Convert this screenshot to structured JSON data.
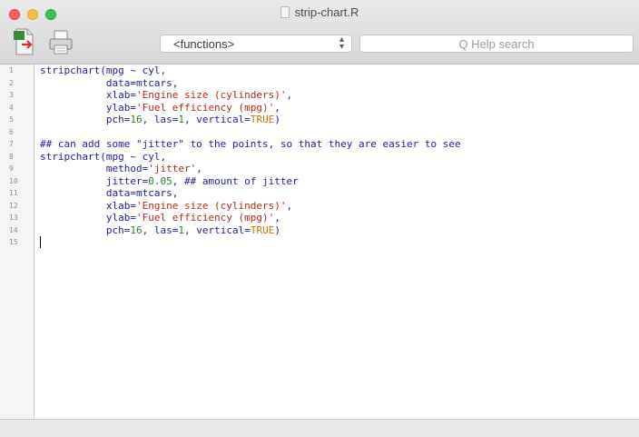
{
  "window": {
    "title": "strip-chart.R"
  },
  "toolbar": {
    "functions_label": "<functions>",
    "help_placeholder": "Q Help search",
    "source_icon": "source-file-icon",
    "print_icon": "printer-icon"
  },
  "editor": {
    "line_numbers": [
      "1",
      "2",
      "3",
      "4",
      "5",
      "6",
      "7",
      "8",
      "9",
      "10",
      "11",
      "12",
      "13",
      "14",
      "15"
    ],
    "lines": [
      [
        {
          "t": "stripchart(mpg ~ cyl,",
          "c": "id"
        }
      ],
      [
        {
          "t": "           data=mtcars,",
          "c": "id"
        }
      ],
      [
        {
          "t": "           xlab=",
          "c": "id"
        },
        {
          "t": "'Engine size (cylinders)'",
          "c": "str"
        },
        {
          "t": ",",
          "c": "id"
        }
      ],
      [
        {
          "t": "           ylab=",
          "c": "id"
        },
        {
          "t": "'Fuel efficiency (mpg)'",
          "c": "str"
        },
        {
          "t": ",",
          "c": "id"
        }
      ],
      [
        {
          "t": "           pch=",
          "c": "id"
        },
        {
          "t": "16",
          "c": "num"
        },
        {
          "t": ", las=",
          "c": "id"
        },
        {
          "t": "1",
          "c": "num"
        },
        {
          "t": ", vertical=",
          "c": "id"
        },
        {
          "t": "TRUE",
          "c": "bool"
        },
        {
          "t": ")",
          "c": "id"
        }
      ],
      [],
      [
        {
          "t": "## can add some \"jitter\" to the points, so that they are easier to see",
          "c": "cmt"
        }
      ],
      [
        {
          "t": "stripchart(mpg ~ cyl,",
          "c": "id"
        }
      ],
      [
        {
          "t": "           method=",
          "c": "id"
        },
        {
          "t": "'jitter'",
          "c": "str"
        },
        {
          "t": ",",
          "c": "id"
        }
      ],
      [
        {
          "t": "           jitter=",
          "c": "id"
        },
        {
          "t": "0.05",
          "c": "num"
        },
        {
          "t": ", ## amount of jitter",
          "c": "cmt"
        }
      ],
      [
        {
          "t": "           data=mtcars,",
          "c": "id"
        }
      ],
      [
        {
          "t": "           xlab=",
          "c": "id"
        },
        {
          "t": "'Engine size (cylinders)'",
          "c": "str"
        },
        {
          "t": ",",
          "c": "id"
        }
      ],
      [
        {
          "t": "           ylab=",
          "c": "id"
        },
        {
          "t": "'Fuel efficiency (mpg)'",
          "c": "str"
        },
        {
          "t": ",",
          "c": "id"
        }
      ],
      [
        {
          "t": "           pch=",
          "c": "id"
        },
        {
          "t": "16",
          "c": "num"
        },
        {
          "t": ", las=",
          "c": "id"
        },
        {
          "t": "1",
          "c": "num"
        },
        {
          "t": ", vertical=",
          "c": "id"
        },
        {
          "t": "TRUE",
          "c": "bool"
        },
        {
          "t": ")",
          "c": "id"
        }
      ],
      []
    ],
    "cursor_line": 15
  },
  "colors": {
    "identifier": "#1d1d9a",
    "string": "#b52a1d",
    "number": "#2b7a2b",
    "boolean": "#c07a00"
  }
}
